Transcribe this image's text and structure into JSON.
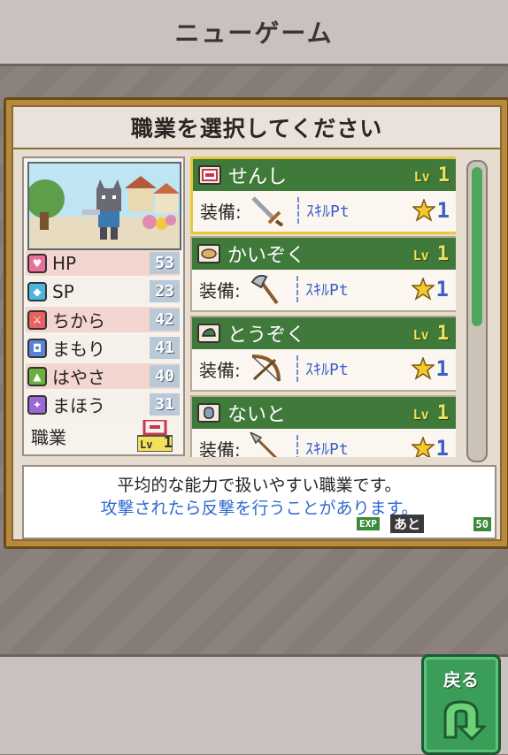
{
  "topbar": {
    "title": "ニューゲーム"
  },
  "panel": {
    "title": "職業を選択してください"
  },
  "stats": [
    {
      "label": "HP",
      "value": "53",
      "icon": "heart-icon",
      "color": "#e8709a"
    },
    {
      "label": "SP",
      "value": "23",
      "icon": "diamond-icon",
      "color": "#4fb3e0"
    },
    {
      "label": "ちから",
      "value": "42",
      "icon": "sword-icon",
      "color": "#e86060"
    },
    {
      "label": "まもり",
      "value": "41",
      "icon": "shield-icon",
      "color": "#5a82d8"
    },
    {
      "label": "はやさ",
      "value": "40",
      "icon": "boot-icon",
      "color": "#6ab040"
    },
    {
      "label": "まほう",
      "value": "31",
      "icon": "magic-icon",
      "color": "#9a68d8"
    }
  ],
  "job_field": {
    "label": "職業",
    "level": "1"
  },
  "jobs": [
    {
      "name": "せんし",
      "lv_prefix": "Lv",
      "level": "1",
      "equip_label": "装備:",
      "equip_icon": "sword-icon",
      "skill_label": "ｽｷﾙPt",
      "skill_points": "1",
      "selected": true
    },
    {
      "name": "かいぞく",
      "lv_prefix": "Lv",
      "level": "1",
      "equip_label": "装備:",
      "equip_icon": "axe-icon",
      "skill_label": "ｽｷﾙPt",
      "skill_points": "1",
      "selected": false
    },
    {
      "name": "とうぞく",
      "lv_prefix": "Lv",
      "level": "1",
      "equip_label": "装備:",
      "equip_icon": "bow-icon",
      "skill_label": "ｽｷﾙPt",
      "skill_points": "1",
      "selected": false
    },
    {
      "name": "ないと",
      "lv_prefix": "Lv",
      "level": "1",
      "equip_label": "装備:",
      "equip_icon": "spear-icon",
      "skill_label": "ｽｷﾙPt",
      "skill_points": "1",
      "selected": false
    }
  ],
  "description": {
    "line1": "平均的な能力で扱いやすい職業です。",
    "line2": "攻撃されたら反撃を行うことがあります。",
    "exp_tag": "EXP",
    "exp_rest": "あと",
    "exp_value": "50"
  },
  "back_button": {
    "label": "戻る"
  },
  "colors": {
    "header_green": "#3f7a3a",
    "frame_gold": "#b88a3c",
    "accent_blue": "#2f6ad0"
  }
}
